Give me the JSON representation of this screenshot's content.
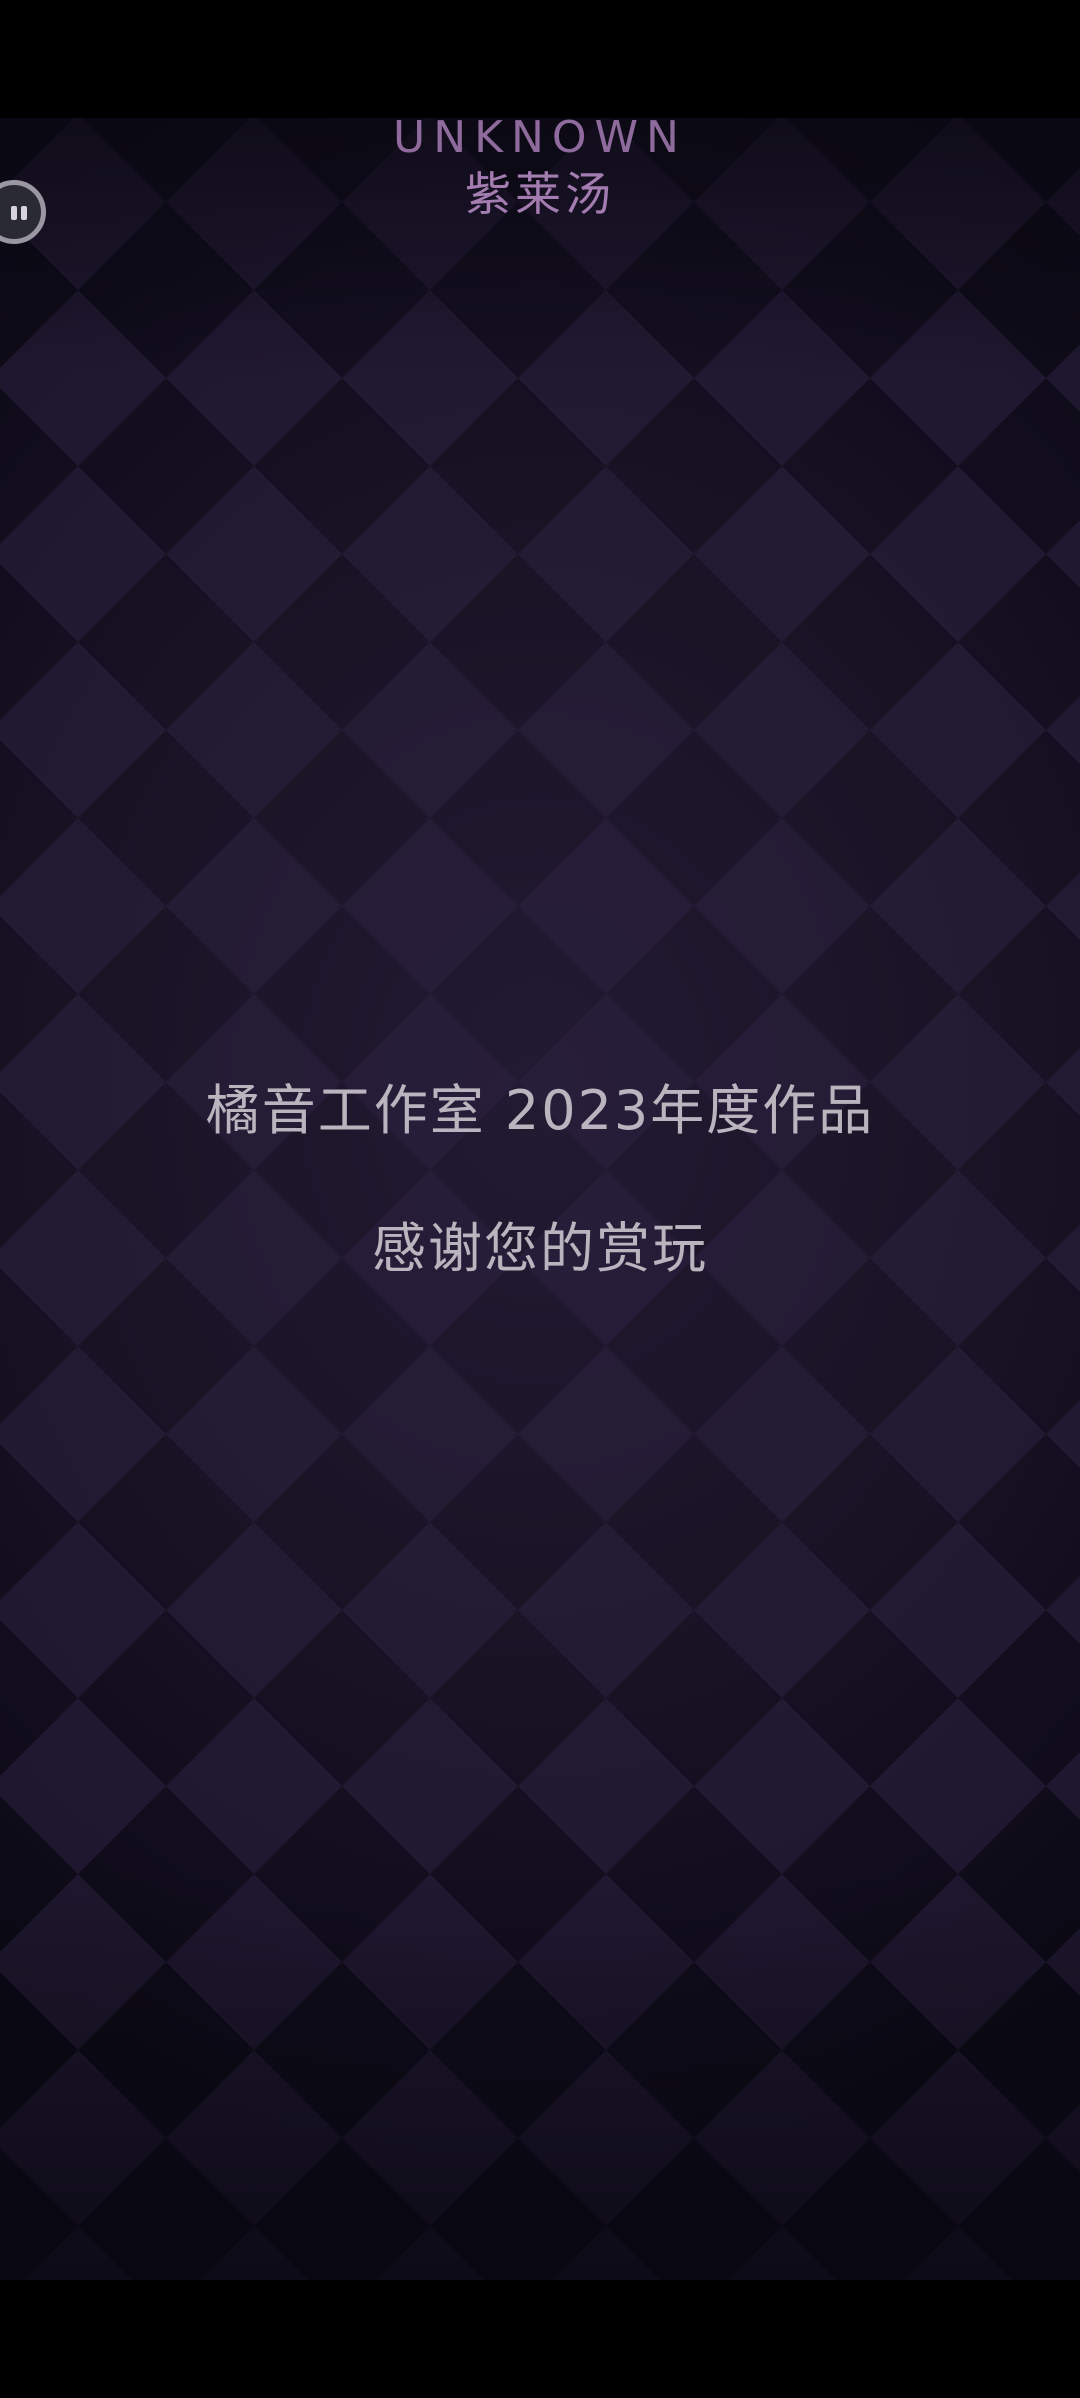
{
  "header": {
    "artist": "UNKNOWN",
    "song_title": "紫莱汤"
  },
  "controls": {
    "pause_icon": "pause-icon"
  },
  "credits": {
    "studio_line": "橘音工作室 2023年度作品",
    "thanks_line": "感谢您的赏玩"
  },
  "colors": {
    "background": "#1a1427",
    "diamond_light": "#2a2038",
    "title_purple": "#a37cb0",
    "credit_text": "#b9b4be"
  }
}
